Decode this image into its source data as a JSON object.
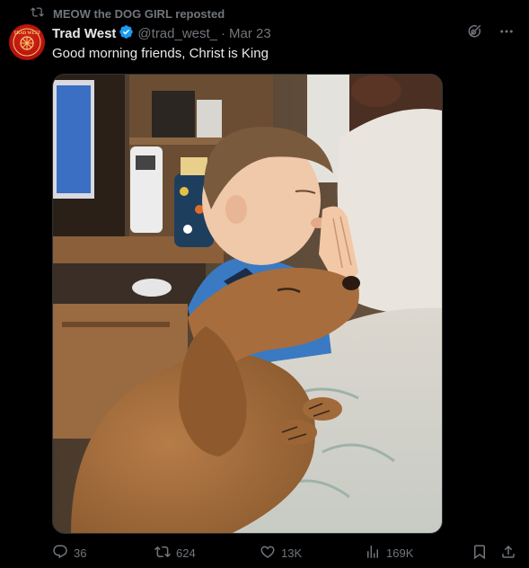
{
  "repost": {
    "icon": "repost-icon",
    "text": "MEOW the DOG GIRL reposted"
  },
  "author": {
    "avatar_icon": "trad-west-logo",
    "avatar_color": "#c91d16",
    "name": "Trad West",
    "verified": true,
    "verified_color": "#1d9bf0",
    "handle": "@trad_west_",
    "separator": "·",
    "date": "Mar 23"
  },
  "top_actions": [
    "grok-icon",
    "more-icon"
  ],
  "tweet": {
    "text": "Good morning friends, Christ is King",
    "media": {
      "kind": "photo",
      "subject": "boy-praying-with-dog"
    }
  },
  "actions": {
    "replies": "36",
    "reposts": "624",
    "likes": "13K",
    "views": "169K",
    "reply_icon": "reply-icon",
    "repost_icon": "repost-icon",
    "like_icon": "heart-icon",
    "views_icon": "analytics-icon",
    "bookmark_icon": "bookmark-icon",
    "share_icon": "share-icon"
  },
  "colors": {
    "background": "#000000",
    "text": "#e7e9ea",
    "muted": "#71767b",
    "accent": "#1d9bf0"
  }
}
